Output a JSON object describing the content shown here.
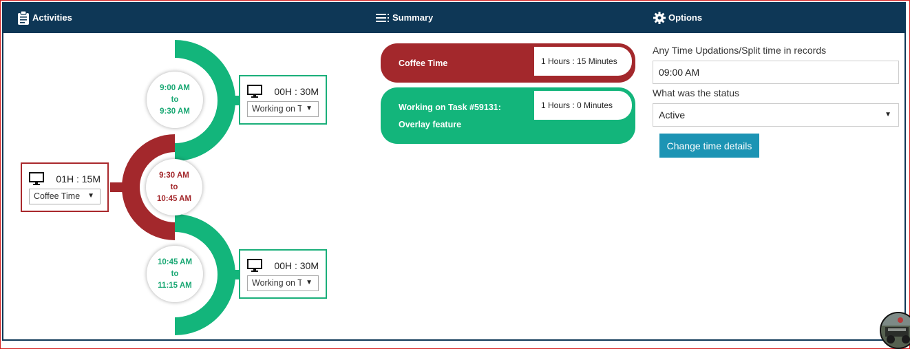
{
  "header": {
    "activities_label": "Activities",
    "summary_label": "Summary",
    "options_label": "Options",
    "icons": {
      "activities": "clipboard-icon",
      "summary": "list-icon",
      "options": "gear-icon"
    }
  },
  "timeline": {
    "segments": [
      {
        "from": "9:00 AM",
        "to_word": "to",
        "to": "9:30 AM",
        "color": "#13b57b",
        "duration": "00H : 30M",
        "activity": "Working on T",
        "side": "right"
      },
      {
        "from": "9:30 AM",
        "to_word": "to",
        "to": "10:45 AM",
        "color": "#a3282c",
        "duration": "01H : 15M",
        "activity": "Coffee Time",
        "side": "left"
      },
      {
        "from": "10:45 AM",
        "to_word": "to",
        "to": "11:15 AM",
        "color": "#13b57b",
        "duration": "00H : 30M",
        "activity": "Working on T",
        "side": "right"
      }
    ]
  },
  "summary": {
    "items": [
      {
        "label_line1": "Coffee Time",
        "label_line2": "",
        "value": "1 Hours : 15 Minutes",
        "color": "#a3282c"
      },
      {
        "label_line1": "Working on Task #59131:",
        "label_line2": "Overlay feature",
        "value": "1 Hours : 0 Minutes",
        "color": "#13b57b"
      }
    ]
  },
  "options": {
    "time_label": "Any Time Updations/Split time in records",
    "time_value": "09:00 AM",
    "status_label": "What was the status",
    "status_value": "Active",
    "submit_label": "Change time details"
  },
  "colors": {
    "navy": "#0e3756",
    "green": "#13b57b",
    "red": "#a3282c",
    "button": "#1c94b4"
  }
}
